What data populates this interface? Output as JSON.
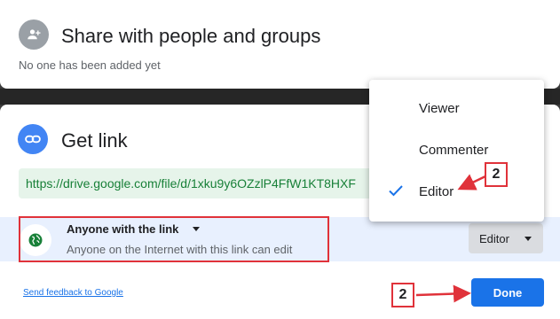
{
  "share_section": {
    "title": "Share with people and groups",
    "empty_text": "No one has been added yet",
    "icon": "person-add-icon"
  },
  "get_link_section": {
    "title": "Get link",
    "icon": "link-icon",
    "link_url": "https://drive.google.com/file/d/1xku9y6OZzlP4FfW1KT8HXF"
  },
  "access": {
    "scope_label": "Anyone with the link",
    "description": "Anyone on the Internet with this link can edit",
    "icon": "globe-icon",
    "role_button_label": "Editor"
  },
  "role_menu": {
    "items": [
      {
        "label": "Viewer",
        "selected": false
      },
      {
        "label": "Commenter",
        "selected": false
      },
      {
        "label": "Editor",
        "selected": true
      }
    ]
  },
  "footer": {
    "feedback_link": "Send feedback to Google",
    "done_label": "Done"
  },
  "annotations": {
    "step_top": "2",
    "step_bottom": "2",
    "highlight_color": "#e0323a"
  },
  "colors": {
    "accent": "#1a73e8",
    "link_bg": "#e6f4ea",
    "link_text": "#188038",
    "access_bg": "#e8f0fe"
  }
}
